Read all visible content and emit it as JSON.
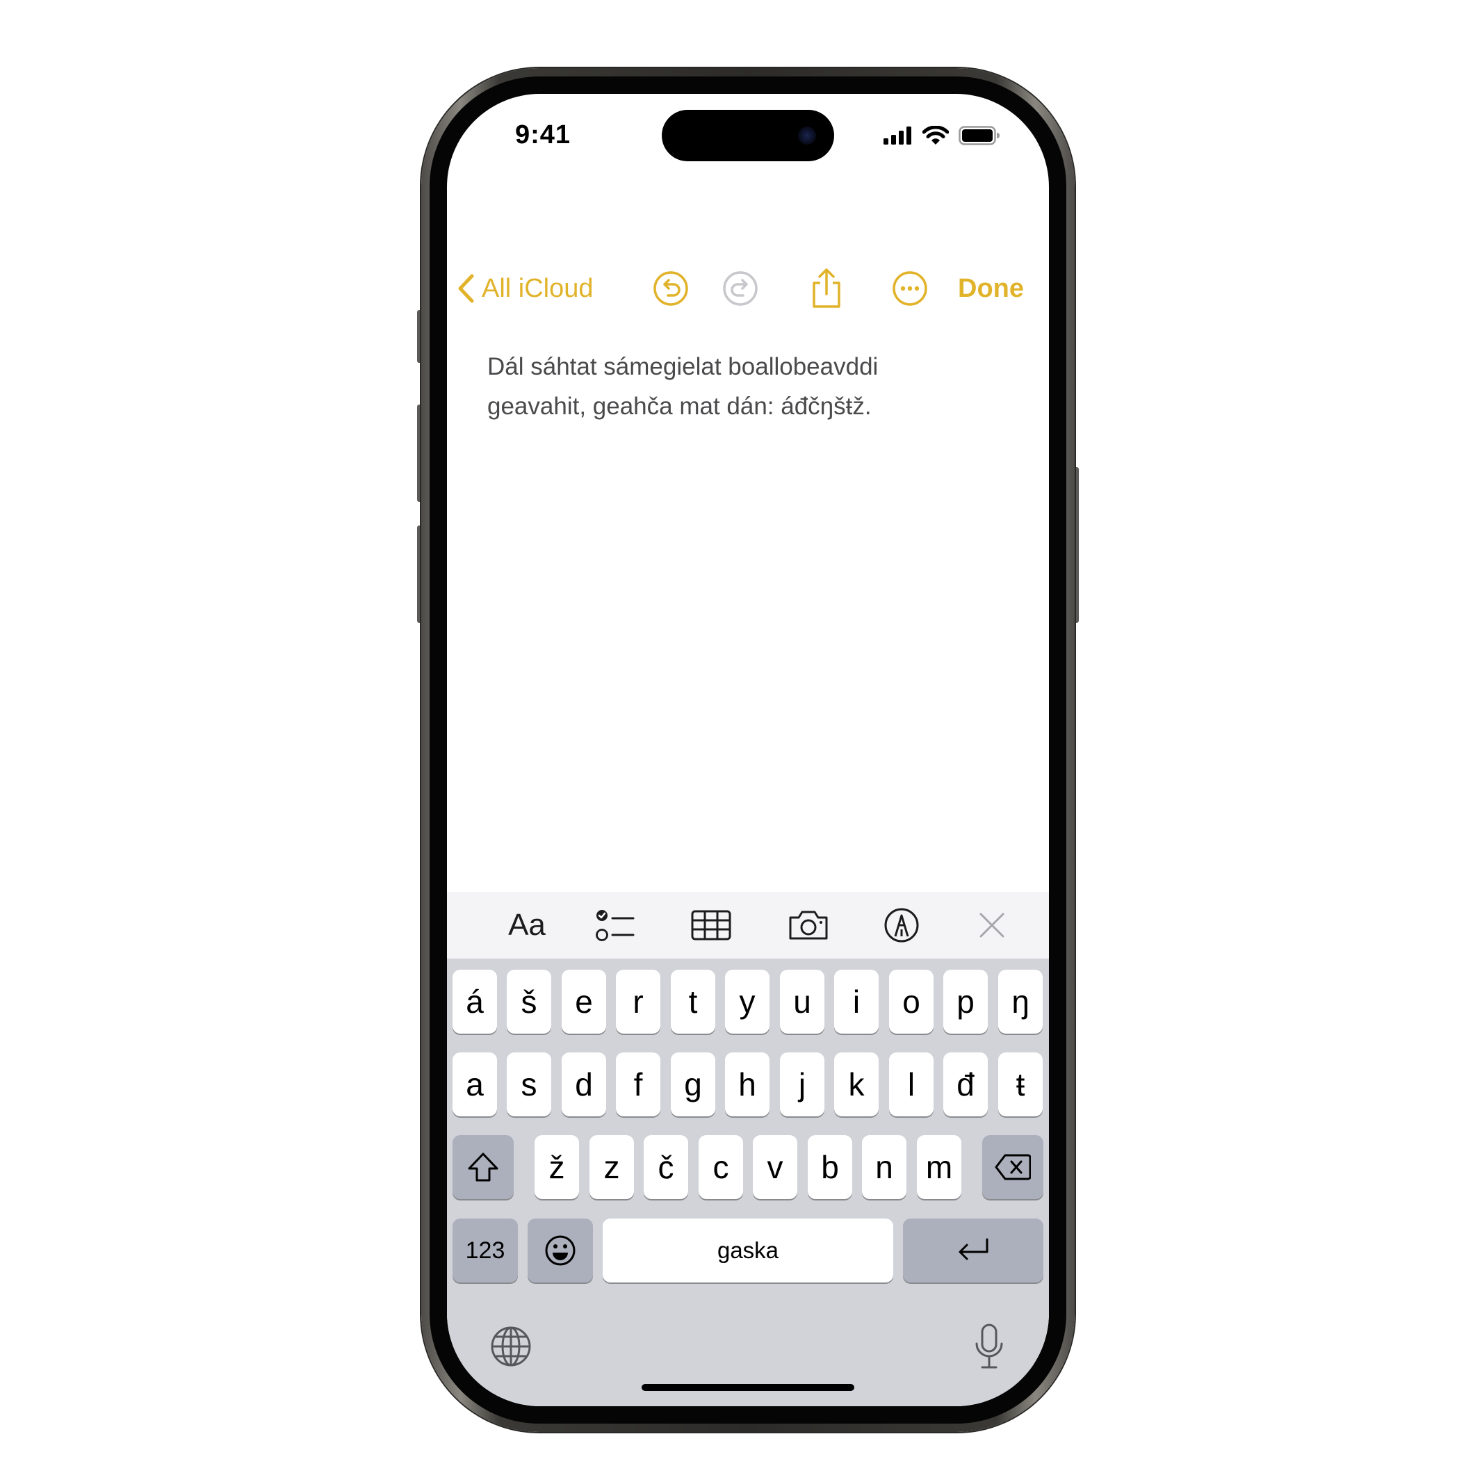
{
  "status_bar": {
    "time": "9:41"
  },
  "nav": {
    "back_label": "All iCloud",
    "done_label": "Done",
    "accent_color": "#e1b32a"
  },
  "note": {
    "line1": "Dál sáhtat sámegielat boallobeavddi",
    "line2": "geavahit, geahča mat dán: áđčŋšŧž."
  },
  "toolbar": {
    "format_label": "Aa",
    "icons": [
      "checklist-icon",
      "table-icon",
      "camera-icon",
      "markup-icon",
      "close-icon"
    ]
  },
  "keyboard": {
    "row1": [
      "á",
      "š",
      "e",
      "r",
      "t",
      "y",
      "u",
      "i",
      "o",
      "p",
      "ŋ"
    ],
    "row2": [
      "a",
      "s",
      "d",
      "f",
      "g",
      "h",
      "j",
      "k",
      "l",
      "đ",
      "ŧ"
    ],
    "row3": [
      "ž",
      "z",
      "č",
      "c",
      "v",
      "b",
      "n",
      "m"
    ],
    "numbers_label": "123",
    "space_label": "gaska"
  }
}
